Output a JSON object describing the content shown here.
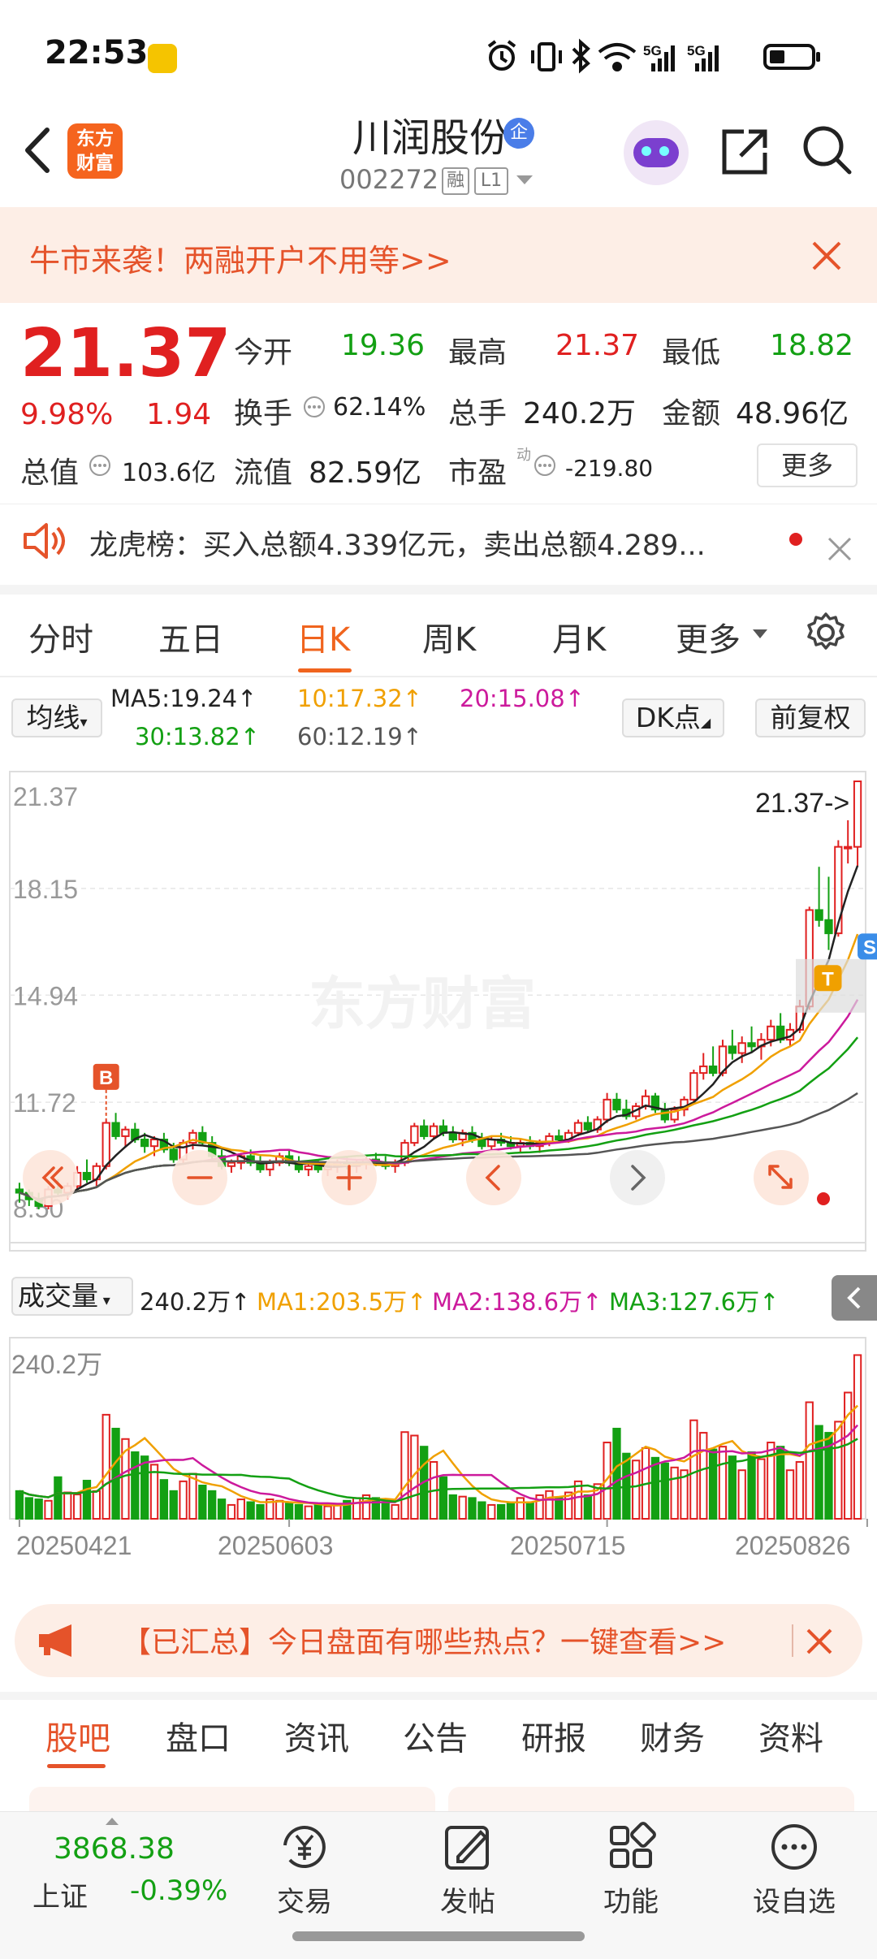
{
  "status_bar": {
    "time": "22:53",
    "network1": "5G",
    "network2": "5G"
  },
  "header": {
    "back_icon": "chevron-left-icon",
    "app_logo": "东方\n财富",
    "stock_name": "川润股份",
    "badge": "企",
    "stock_code": "002272",
    "tag1": "融",
    "tag2": "L1",
    "icons": [
      "assistant-robot-icon",
      "share-icon",
      "search-icon"
    ]
  },
  "promo": {
    "text": "牛市来袭！两融开户不用等>>"
  },
  "quote": {
    "price": "21.37",
    "change_pct": "9.98%",
    "change_amt": "1.94",
    "open_label": "今开",
    "open": "19.36",
    "high_label": "最高",
    "high": "21.37",
    "low_label": "最低",
    "low": "18.82",
    "turnover_label": "换手",
    "turnover": "62.14%",
    "volume_label": "总手",
    "volume": "240.2万",
    "amount_label": "金额",
    "amount": "48.96亿",
    "mktcap_label": "总值",
    "mktcap": "103.6亿",
    "float_label": "流值",
    "float": "82.59亿",
    "pe_label": "市盈",
    "pe_sup": "动",
    "pe": "-219.80",
    "more_button": "更多"
  },
  "lhb": {
    "text": "龙虎榜：买入总额4.339亿元，卖出总额4.289..."
  },
  "period_tabs": [
    {
      "label": "分时"
    },
    {
      "label": "五日"
    },
    {
      "label": "日K"
    },
    {
      "label": "周K"
    },
    {
      "label": "月K"
    },
    {
      "label": "更多"
    }
  ],
  "active_period": "日K",
  "chart_header": {
    "ma_button": "均线",
    "ma5": "MA5:19.24↑",
    "ma10": "10:17.32↑",
    "ma20": "20:15.08↑",
    "ma30": "30:13.82↑",
    "ma60": "60:12.19↑",
    "dk_button": "DK点",
    "adjust_button": "前复权"
  },
  "colors": {
    "up": "#e02020",
    "down": "#13a013",
    "ma5": "#222222",
    "ma10": "#f0a000",
    "ma20": "#cc1a9c",
    "ma30": "#13a013",
    "ma60": "#555555",
    "accent": "#f0641e"
  },
  "chart_data": {
    "type": "candlestick",
    "price_axis_labels": [
      "21.37",
      "18.15",
      "14.94",
      "11.72",
      "8.50"
    ],
    "ylim": [
      8.5,
      21.37
    ],
    "last_price_label": "21.37->",
    "markers": {
      "buy": "B",
      "trade": "T",
      "sell": "S"
    },
    "ohlc": [
      [
        9.1,
        9.3,
        8.7,
        9.0
      ],
      [
        9.0,
        9.1,
        8.6,
        8.8
      ],
      [
        8.8,
        9.0,
        8.5,
        8.6
      ],
      [
        8.6,
        9.2,
        8.5,
        9.1
      ],
      [
        9.1,
        9.4,
        8.9,
        9.0
      ],
      [
        9.0,
        9.3,
        8.8,
        9.2
      ],
      [
        9.2,
        9.8,
        9.1,
        9.6
      ],
      [
        9.6,
        10.0,
        9.3,
        9.4
      ],
      [
        9.4,
        9.9,
        9.2,
        9.8
      ],
      [
        9.8,
        11.2,
        9.7,
        11.1
      ],
      [
        11.1,
        11.4,
        10.6,
        10.7
      ],
      [
        10.7,
        11.0,
        10.4,
        10.9
      ],
      [
        10.9,
        11.1,
        10.5,
        10.6
      ],
      [
        10.6,
        10.8,
        10.2,
        10.4
      ],
      [
        10.4,
        10.7,
        10.1,
        10.6
      ],
      [
        10.6,
        10.8,
        10.2,
        10.3
      ],
      [
        10.3,
        10.5,
        9.9,
        10.0
      ],
      [
        10.0,
        10.6,
        9.9,
        10.5
      ],
      [
        10.5,
        10.9,
        10.3,
        10.8
      ],
      [
        10.8,
        11.0,
        10.4,
        10.5
      ],
      [
        10.5,
        10.7,
        10.0,
        10.1
      ],
      [
        10.1,
        10.3,
        9.7,
        9.8
      ],
      [
        9.8,
        10.0,
        9.6,
        9.9
      ],
      [
        9.9,
        10.2,
        9.7,
        10.1
      ],
      [
        10.1,
        10.3,
        9.8,
        9.9
      ],
      [
        9.9,
        10.1,
        9.6,
        9.7
      ],
      [
        9.7,
        10.0,
        9.5,
        9.9
      ],
      [
        9.9,
        10.2,
        9.8,
        10.1
      ],
      [
        10.1,
        10.3,
        9.8,
        9.9
      ],
      [
        9.9,
        10.1,
        9.6,
        9.7
      ],
      [
        9.7,
        9.9,
        9.5,
        9.8
      ],
      [
        9.8,
        10.0,
        9.6,
        9.7
      ],
      [
        9.7,
        9.9,
        9.5,
        9.8
      ],
      [
        9.8,
        10.0,
        9.6,
        9.9
      ],
      [
        9.9,
        10.1,
        9.7,
        9.8
      ],
      [
        9.8,
        10.0,
        9.6,
        9.9
      ],
      [
        9.9,
        10.1,
        9.7,
        10.0
      ],
      [
        10.0,
        10.2,
        9.8,
        9.9
      ],
      [
        9.9,
        10.1,
        9.7,
        9.8
      ],
      [
        9.8,
        10.0,
        9.6,
        9.9
      ],
      [
        9.9,
        10.6,
        9.8,
        10.5
      ],
      [
        10.5,
        11.1,
        10.4,
        11.0
      ],
      [
        11.0,
        11.2,
        10.6,
        10.7
      ],
      [
        10.7,
        11.1,
        10.6,
        11.0
      ],
      [
        11.0,
        11.2,
        10.7,
        10.8
      ],
      [
        10.8,
        11.0,
        10.5,
        10.6
      ],
      [
        10.6,
        10.9,
        10.4,
        10.8
      ],
      [
        10.8,
        11.0,
        10.5,
        10.6
      ],
      [
        10.6,
        10.8,
        10.3,
        10.4
      ],
      [
        10.4,
        10.7,
        10.3,
        10.6
      ],
      [
        10.6,
        10.8,
        10.4,
        10.5
      ],
      [
        10.5,
        10.7,
        10.3,
        10.4
      ],
      [
        10.4,
        10.6,
        10.2,
        10.5
      ],
      [
        10.5,
        10.7,
        10.3,
        10.4
      ],
      [
        10.4,
        10.6,
        10.2,
        10.5
      ],
      [
        10.5,
        10.8,
        10.4,
        10.7
      ],
      [
        10.7,
        10.9,
        10.5,
        10.6
      ],
      [
        10.6,
        10.9,
        10.5,
        10.8
      ],
      [
        10.8,
        11.2,
        10.7,
        11.1
      ],
      [
        11.1,
        11.3,
        10.8,
        10.9
      ],
      [
        10.9,
        11.3,
        10.8,
        11.2
      ],
      [
        11.2,
        12.0,
        11.1,
        11.8
      ],
      [
        11.8,
        12.0,
        11.4,
        11.5
      ],
      [
        11.5,
        11.8,
        11.2,
        11.3
      ],
      [
        11.3,
        11.7,
        11.2,
        11.6
      ],
      [
        11.6,
        12.1,
        11.5,
        11.9
      ],
      [
        11.9,
        12.0,
        11.4,
        11.5
      ],
      [
        11.5,
        11.7,
        11.1,
        11.2
      ],
      [
        11.2,
        11.6,
        11.1,
        11.5
      ],
      [
        11.5,
        11.9,
        11.3,
        11.8
      ],
      [
        11.8,
        12.7,
        11.7,
        12.6
      ],
      [
        12.6,
        13.2,
        12.4,
        12.8
      ],
      [
        12.8,
        13.4,
        12.5,
        12.6
      ],
      [
        12.6,
        13.6,
        12.5,
        13.4
      ],
      [
        13.4,
        13.9,
        13.0,
        13.2
      ],
      [
        13.2,
        13.7,
        12.9,
        13.5
      ],
      [
        13.5,
        14.0,
        13.2,
        13.4
      ],
      [
        13.4,
        13.8,
        13.0,
        13.6
      ],
      [
        13.6,
        14.2,
        13.4,
        14.0
      ],
      [
        14.0,
        14.4,
        13.5,
        13.6
      ],
      [
        13.6,
        14.1,
        13.4,
        13.9
      ],
      [
        13.9,
        14.8,
        13.8,
        14.6
      ],
      [
        14.6,
        17.6,
        14.5,
        17.5
      ],
      [
        17.5,
        18.8,
        17.0,
        17.2
      ],
      [
        17.2,
        18.5,
        16.3,
        16.8
      ],
      [
        16.8,
        19.6,
        16.7,
        19.4
      ],
      [
        19.4,
        20.2,
        18.9,
        19.4
      ],
      [
        19.4,
        21.37,
        18.82,
        21.37
      ]
    ],
    "volume_axis_label": "240.2万",
    "volume_header": {
      "dropdown": "成交量",
      "current": "240.2万↑",
      "ma1": "MA1:203.5万↑",
      "ma2": "MA2:138.6万↑",
      "ma3": "MA3:127.6万↑"
    },
    "volume": [
      40,
      30,
      28,
      26,
      60,
      38,
      35,
      55,
      40,
      150,
      130,
      115,
      96,
      90,
      78,
      56,
      40,
      54,
      65,
      48,
      40,
      28,
      20,
      28,
      24,
      20,
      28,
      26,
      22,
      20,
      18,
      20,
      18,
      20,
      26,
      30,
      34,
      30,
      24,
      20,
      125,
      120,
      104,
      82,
      60,
      34,
      32,
      30,
      24,
      20,
      20,
      24,
      30,
      24,
      34,
      40,
      30,
      38,
      54,
      34,
      50,
      110,
      130,
      94,
      84,
      102,
      88,
      80,
      74,
      70,
      142,
      124,
      100,
      104,
      90,
      70,
      96,
      86,
      110,
      104,
      70,
      82,
      168,
      134,
      124,
      140,
      182,
      236
    ],
    "x_tick_labels": [
      "20250421",
      "20250603",
      "20250715",
      "20250826"
    ]
  },
  "chart_controls": [
    "double-left-icon",
    "zoom-out-icon",
    "zoom-in-icon",
    "prev-icon",
    "next-icon",
    "expand-icon"
  ],
  "hot_banner": {
    "text": "【已汇总】今日盘面有哪些热点？一键查看>>"
  },
  "bottom_tabs": [
    {
      "label": "股吧"
    },
    {
      "label": "盘口"
    },
    {
      "label": "资讯"
    },
    {
      "label": "公告"
    },
    {
      "label": "研报"
    },
    {
      "label": "财务"
    },
    {
      "label": "资料"
    }
  ],
  "bottom_nav": {
    "index_value": "3868.38",
    "index_name": "上证",
    "index_change": "-0.39%",
    "items": [
      {
        "label": "交易",
        "icon": "trade-yen-icon"
      },
      {
        "label": "发帖",
        "icon": "edit-post-icon"
      },
      {
        "label": "功能",
        "icon": "grid-functions-icon"
      },
      {
        "label": "设自选",
        "icon": "more-dots-icon"
      }
    ]
  }
}
